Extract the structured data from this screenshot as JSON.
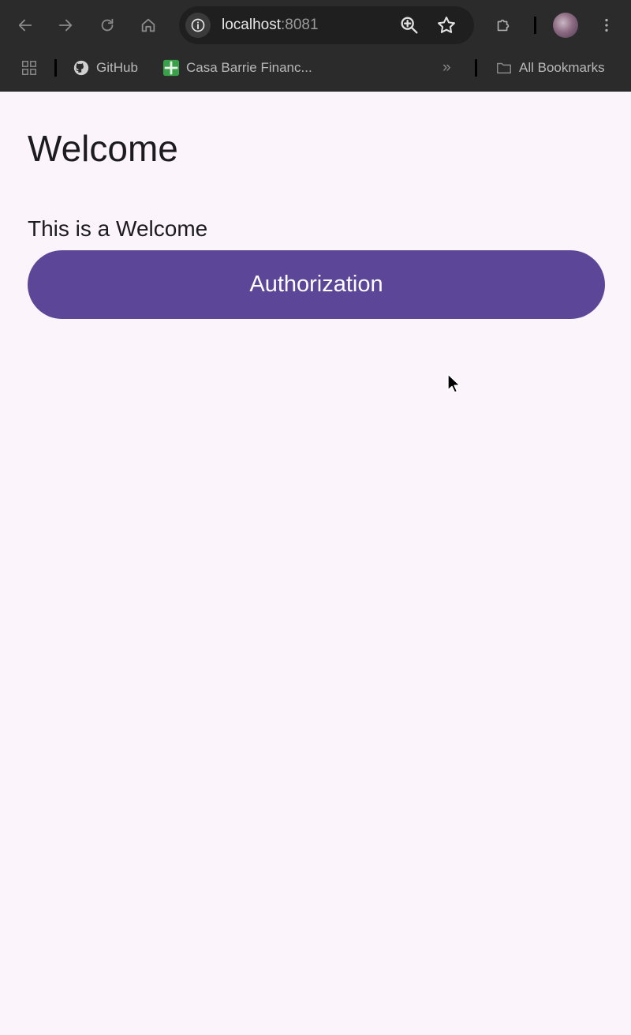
{
  "browser": {
    "url_host": "localhost",
    "url_port": ":8081",
    "bookmarks": [
      {
        "label": "GitHub",
        "icon": "github-icon"
      },
      {
        "label": "Casa Barrie Financ...",
        "icon": "casa-barrie-favicon"
      }
    ],
    "all_bookmarks_label": "All Bookmarks",
    "overflow_label": "»"
  },
  "page": {
    "title": "Welcome",
    "message": "This is a Welcome",
    "auth_button_label": "Authorization"
  },
  "colors": {
    "chrome_bg": "#2b2b2b",
    "page_bg": "#fbf4fb",
    "button_bg": "#5b4698",
    "button_text": "#ffffff",
    "text": "#1c1b1f"
  }
}
